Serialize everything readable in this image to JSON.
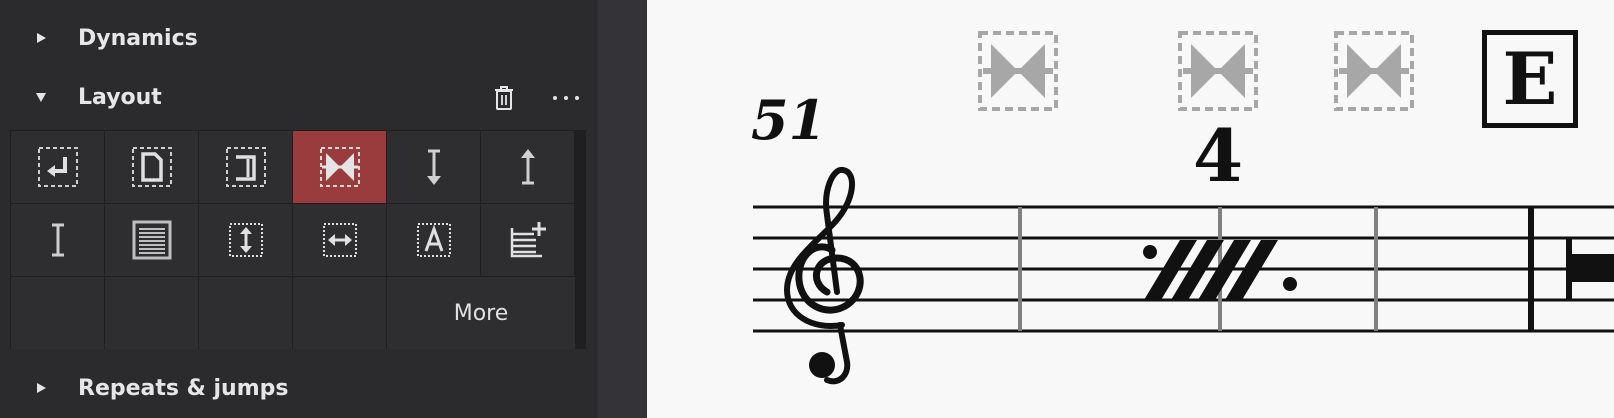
{
  "sidebar": {
    "sections": [
      {
        "label": "Dynamics",
        "expanded": false
      },
      {
        "label": "Layout",
        "expanded": true
      },
      {
        "label": "Repeats & jumps",
        "expanded": false
      }
    ],
    "layout": {
      "delete_icon": "trash-icon",
      "menu_icon": "more-horizontal-icon",
      "palette": {
        "cells": [
          {
            "name": "system-break",
            "icon": "system-break-icon",
            "selected": false
          },
          {
            "name": "page-break",
            "icon": "page-break-icon",
            "selected": false
          },
          {
            "name": "section-break",
            "icon": "section-break-icon",
            "selected": false
          },
          {
            "name": "keep-measures-together",
            "icon": "keep-measures-together-icon",
            "selected": true
          },
          {
            "name": "staff-spacer-down",
            "icon": "staff-spacer-down-icon",
            "selected": false
          },
          {
            "name": "staff-spacer-up",
            "icon": "staff-spacer-up-icon",
            "selected": false
          },
          {
            "name": "staff-spacer-fixed",
            "icon": "staff-spacer-fixed-icon",
            "selected": false
          },
          {
            "name": "staff-type-change",
            "icon": "staff-type-change-icon",
            "selected": false
          },
          {
            "name": "insert-vertical-frame",
            "icon": "vertical-frame-icon",
            "selected": false
          },
          {
            "name": "insert-horizontal-frame",
            "icon": "horizontal-frame-icon",
            "selected": false
          },
          {
            "name": "insert-text-frame",
            "icon": "text-frame-icon",
            "selected": false
          },
          {
            "name": "insert-fretboard-diagram-legend",
            "icon": "add-staff-lines-icon",
            "selected": false
          }
        ],
        "more_label": "More"
      }
    }
  },
  "score": {
    "measure_number": "51",
    "multirest_number": "4",
    "rehearsal_mark": "E",
    "colors": {
      "selection_accent": "#9a3b3d",
      "lock_marker": "#a7a7a7"
    }
  }
}
